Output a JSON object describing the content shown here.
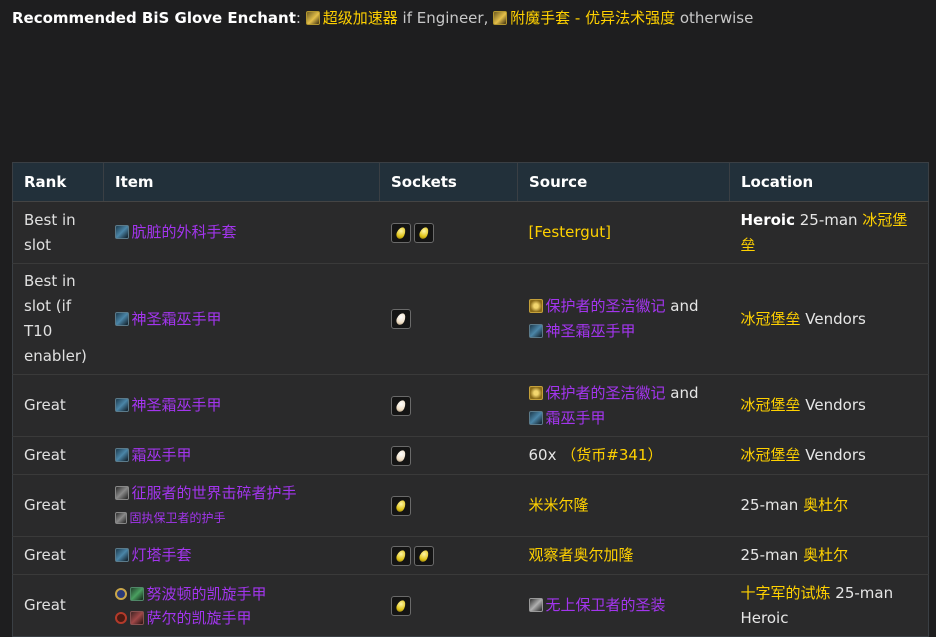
{
  "header": {
    "label": "Recommended BiS Glove Enchant",
    "colon": ":",
    "enchant_engineer": "超级加速器",
    "if_engineer": "if Engineer,",
    "enchant_other": "附魔手套 - 优异法术强度",
    "otherwise": "otherwise"
  },
  "table": {
    "columns": [
      "Rank",
      "Item",
      "Sockets",
      "Source",
      "Location"
    ],
    "rows": [
      {
        "rank": "Best in slot",
        "items": [
          {
            "name": "肮脏的外科手套",
            "icon": "glove-icon"
          }
        ],
        "sockets": [
          "yellow",
          "yellow"
        ],
        "source_parts": [
          {
            "text": "[Festergut]",
            "color": "gold"
          }
        ],
        "location_bold": "Heroic",
        "location_text": "25-man",
        "location_place": "冰冠堡垒"
      },
      {
        "rank": "Best in slot (if T10 enabler)",
        "items": [
          {
            "name": "神圣霜巫手甲",
            "icon": "glove-icon"
          }
        ],
        "sockets": [
          "meta"
        ],
        "source_parts": [
          {
            "text": "保护者的圣洁徽记",
            "color": "purple",
            "icon": "token-icon"
          },
          {
            "text": "and",
            "color": "white"
          },
          {
            "text": "神圣霜巫手甲",
            "color": "purple",
            "icon": "glove-icon"
          }
        ],
        "location_place": "冰冠堡垒",
        "location_text": "Vendors"
      },
      {
        "rank": "Great",
        "items": [
          {
            "name": "神圣霜巫手甲",
            "icon": "glove-icon"
          }
        ],
        "sockets": [
          "meta"
        ],
        "source_parts": [
          {
            "text": "保护者的圣洁徽记",
            "color": "purple",
            "icon": "token-icon"
          },
          {
            "text": "and",
            "color": "white"
          },
          {
            "text": "霜巫手甲",
            "color": "purple",
            "icon": "glove-icon"
          }
        ],
        "location_place": "冰冠堡垒",
        "location_text": "Vendors"
      },
      {
        "rank": "Great",
        "items": [
          {
            "name": "霜巫手甲",
            "icon": "glove-icon"
          }
        ],
        "sockets": [
          "meta"
        ],
        "source_parts": [
          {
            "text": "60x",
            "color": "white"
          },
          {
            "text": "（货币#341）",
            "color": "gold"
          }
        ],
        "location_place": "冰冠堡垒",
        "location_text": "Vendors"
      },
      {
        "rank": "Great",
        "items": [
          {
            "name": "征服者的世界击碎者护手",
            "icon": "glove2-icon"
          },
          {
            "name": "固执保卫者的护手",
            "icon": "glove2-icon",
            "small": true
          }
        ],
        "sockets": [
          "yellow"
        ],
        "source_parts": [
          {
            "text": "米米尔隆",
            "color": "gold"
          }
        ],
        "location_text": "25-man",
        "location_place": "奥杜尔"
      },
      {
        "rank": "Great",
        "items": [
          {
            "name": "灯塔手套",
            "icon": "glove-icon"
          }
        ],
        "sockets": [
          "yellow",
          "yellow"
        ],
        "source_parts": [
          {
            "text": "观察者奥尔加隆",
            "color": "gold"
          }
        ],
        "location_text": "25-man",
        "location_place": "奥杜尔"
      },
      {
        "rank": "Great",
        "items": [
          {
            "name": "努波顿的凯旋手甲",
            "icon": "glove4-icon",
            "faction": "alliance"
          },
          {
            "name": "萨尔的凯旋手甲",
            "icon": "glove3-icon",
            "faction": "horde"
          }
        ],
        "sockets": [
          "yellow"
        ],
        "source_parts": [
          {
            "text": "无上保卫者的圣装",
            "color": "purple",
            "icon": "chest-icon"
          }
        ],
        "location_place": "十字军的试炼",
        "location_text": "25-man",
        "location_after": "Heroic"
      }
    ]
  }
}
